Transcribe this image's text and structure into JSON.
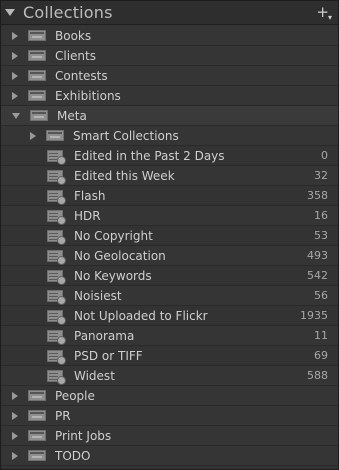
{
  "panel": {
    "title": "Collections",
    "add_symbol": "+",
    "add_caret": "▾"
  },
  "top_items": [
    {
      "label": "Books"
    },
    {
      "label": "Clients"
    },
    {
      "label": "Contests"
    },
    {
      "label": "Exhibitions"
    }
  ],
  "meta": {
    "label": "Meta",
    "children": [
      {
        "label": "Smart Collections",
        "count": ""
      },
      {
        "label": "Edited in the Past 2 Days",
        "count": "0"
      },
      {
        "label": "Edited this Week",
        "count": "32"
      },
      {
        "label": "Flash",
        "count": "358"
      },
      {
        "label": "HDR",
        "count": "16"
      },
      {
        "label": "No Copyright",
        "count": "53"
      },
      {
        "label": "No Geolocation",
        "count": "493"
      },
      {
        "label": "No Keywords",
        "count": "542"
      },
      {
        "label": "Noisiest",
        "count": "56"
      },
      {
        "label": "Not Uploaded to Flickr",
        "count": "1935"
      },
      {
        "label": "Panorama",
        "count": "11"
      },
      {
        "label": "PSD or TIFF",
        "count": "69"
      },
      {
        "label": "Widest",
        "count": "588"
      }
    ]
  },
  "bottom_items": [
    {
      "label": "People"
    },
    {
      "label": "PR"
    },
    {
      "label": "Print Jobs"
    },
    {
      "label": "TODO"
    }
  ]
}
